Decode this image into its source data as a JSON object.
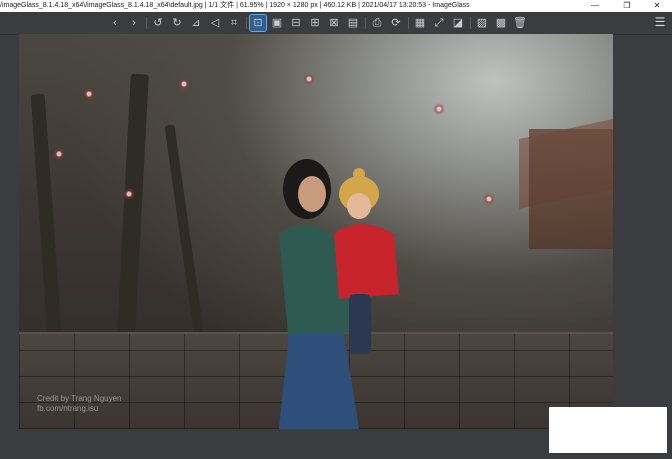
{
  "window": {
    "title": "/imageGlass_8.1.4.18_x64\\/imageGlass_8.1.4.18_x64\\default.jpg  |  1/1 文件  |  61.95%  |  1920 × 1280 px  |  460.12 KB  |  2021/04/17 13:20:53  - ImageGlass",
    "minimize": "—",
    "maximize": "❐",
    "close": "✕"
  },
  "toolbar": {
    "items": [
      {
        "name": "prev-image",
        "glyph": "‹"
      },
      {
        "name": "next-image",
        "glyph": "›"
      },
      {
        "name": "rotate-left",
        "glyph": "↺"
      },
      {
        "name": "rotate-right",
        "glyph": "↻"
      },
      {
        "name": "flip-horizontal",
        "glyph": "⊿"
      },
      {
        "name": "flip-vertical",
        "glyph": "◁"
      },
      {
        "name": "crop",
        "glyph": "⌗"
      },
      {
        "name": "auto-zoom",
        "glyph": "⊡"
      },
      {
        "name": "lock-zoom",
        "glyph": "▣"
      },
      {
        "name": "scale-to-width",
        "glyph": "⊟"
      },
      {
        "name": "scale-to-height",
        "glyph": "⊞"
      },
      {
        "name": "scale-to-fit",
        "glyph": "⊠"
      },
      {
        "name": "scale-to-fill",
        "glyph": "▤"
      },
      {
        "name": "open-with",
        "glyph": "⎙"
      },
      {
        "name": "refresh",
        "glyph": "⟳"
      },
      {
        "name": "gallery-toggle",
        "glyph": "▦"
      },
      {
        "name": "fullscreen",
        "glyph": "⤢"
      },
      {
        "name": "slideshow",
        "glyph": "◪"
      },
      {
        "name": "set-wallpaper",
        "glyph": "▨"
      },
      {
        "name": "thumbnail-grid",
        "glyph": "▩"
      },
      {
        "name": "delete",
        "glyph": "🗑"
      }
    ],
    "menu_glyph": "☰"
  },
  "image": {
    "credit_line1": "Credit by Trang Nguyen",
    "credit_line2": "fb.com/ntrang.isu"
  }
}
